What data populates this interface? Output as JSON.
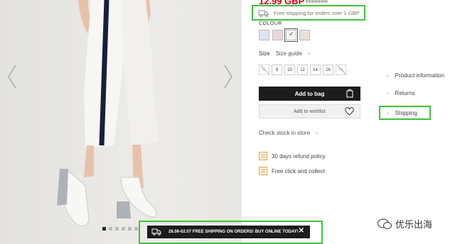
{
  "product": {
    "price": "12.99 GBP",
    "old_price": "£££££££"
  },
  "shipping_banner": {
    "text": "Free shipping for orders over 1 GBP",
    "icon": "truck-icon"
  },
  "colour": {
    "label": "COLOUR",
    "swatches": [
      {
        "name": "light blue",
        "color": "#dde6ee"
      },
      {
        "name": "pink",
        "color": "#ead8de"
      },
      {
        "name": "white",
        "color": "#f4f4f2",
        "selected": true
      },
      {
        "name": "beige",
        "color": "#e6e2db"
      }
    ]
  },
  "size": {
    "label": "Size",
    "guide": "Size guide",
    "options": [
      {
        "value": "6",
        "available": false
      },
      {
        "value": "8",
        "available": true
      },
      {
        "value": "10",
        "available": true
      },
      {
        "value": "12",
        "available": true
      },
      {
        "value": "14",
        "available": true
      },
      {
        "value": "16",
        "available": true
      },
      {
        "value": "18",
        "available": false
      }
    ]
  },
  "buttons": {
    "add_to_bag": "Add to bag",
    "add_to_wishlist": "Add to wishlist"
  },
  "check_stock": "Check stock in store",
  "perks": [
    {
      "text": "30 days refund policy",
      "icon": "calendar-icon"
    },
    {
      "text": "Free click and collect",
      "icon": "calendar-icon"
    }
  ],
  "side_links": {
    "product_information": "Product information",
    "returns": "Returns",
    "shipping": "Shipping"
  },
  "notice": {
    "text": "28.06-02.07 FREE SHIPPING ON ORDERS! BUY ONLINE TODAY!",
    "close": "✕"
  },
  "watermark": {
    "text": "优乐出海"
  },
  "colors": {
    "highlight": "#3ec23e",
    "price": "#d0021b",
    "dark_button": "#1c1c1c"
  }
}
